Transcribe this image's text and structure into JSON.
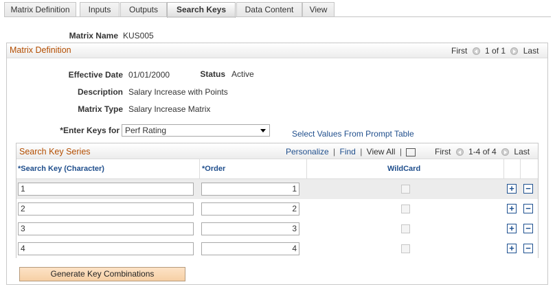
{
  "tabs": [
    {
      "label": "Matrix Definition"
    },
    {
      "label": "Inputs"
    },
    {
      "label": "Outputs"
    },
    {
      "label": "Search Keys"
    },
    {
      "label": "Data Content"
    },
    {
      "label": "View"
    }
  ],
  "matrix": {
    "name_label": "Matrix Name",
    "name_value": "KUS005"
  },
  "definition_group": {
    "title": "Matrix Definition",
    "nav": {
      "first": "First",
      "range": "1 of 1",
      "last": "Last"
    },
    "effective_date_label": "Effective Date",
    "effective_date_value": "01/01/2000",
    "status_label": "Status",
    "status_value": "Active",
    "description_label": "Description",
    "description_value": "Salary Increase with Points",
    "matrix_type_label": "Matrix Type",
    "matrix_type_value": "Salary Increase Matrix",
    "enter_keys_label": "*Enter Keys for",
    "enter_keys_value": "Perf Rating",
    "prompt_link": "Select Values From Prompt Table"
  },
  "grid": {
    "title": "Search Key Series",
    "personalize": "Personalize",
    "find": "Find",
    "view_all": "View All",
    "sep": "|",
    "nav": {
      "first": "First",
      "range": "1-4 of 4",
      "last": "Last"
    },
    "columns": {
      "search_key": "*Search Key (Character)",
      "order": "*Order",
      "wildcard": "WildCard"
    },
    "rows": [
      {
        "key": "1",
        "order": "1",
        "wildcard": false
      },
      {
        "key": "2",
        "order": "2",
        "wildcard": false
      },
      {
        "key": "3",
        "order": "3",
        "wildcard": false
      },
      {
        "key": "4",
        "order": "4",
        "wildcard": false
      }
    ],
    "add_symbol": "+",
    "delete_symbol": "−"
  },
  "generate_button": "Generate Key Combinations",
  "icons": {
    "prev": "circle-left-arrow-icon",
    "next": "circle-right-arrow-icon",
    "expand": "expand-grid-icon"
  },
  "colors": {
    "accent": "#b34d00",
    "link": "#1f4e8c",
    "button": "#f6cfa5"
  }
}
